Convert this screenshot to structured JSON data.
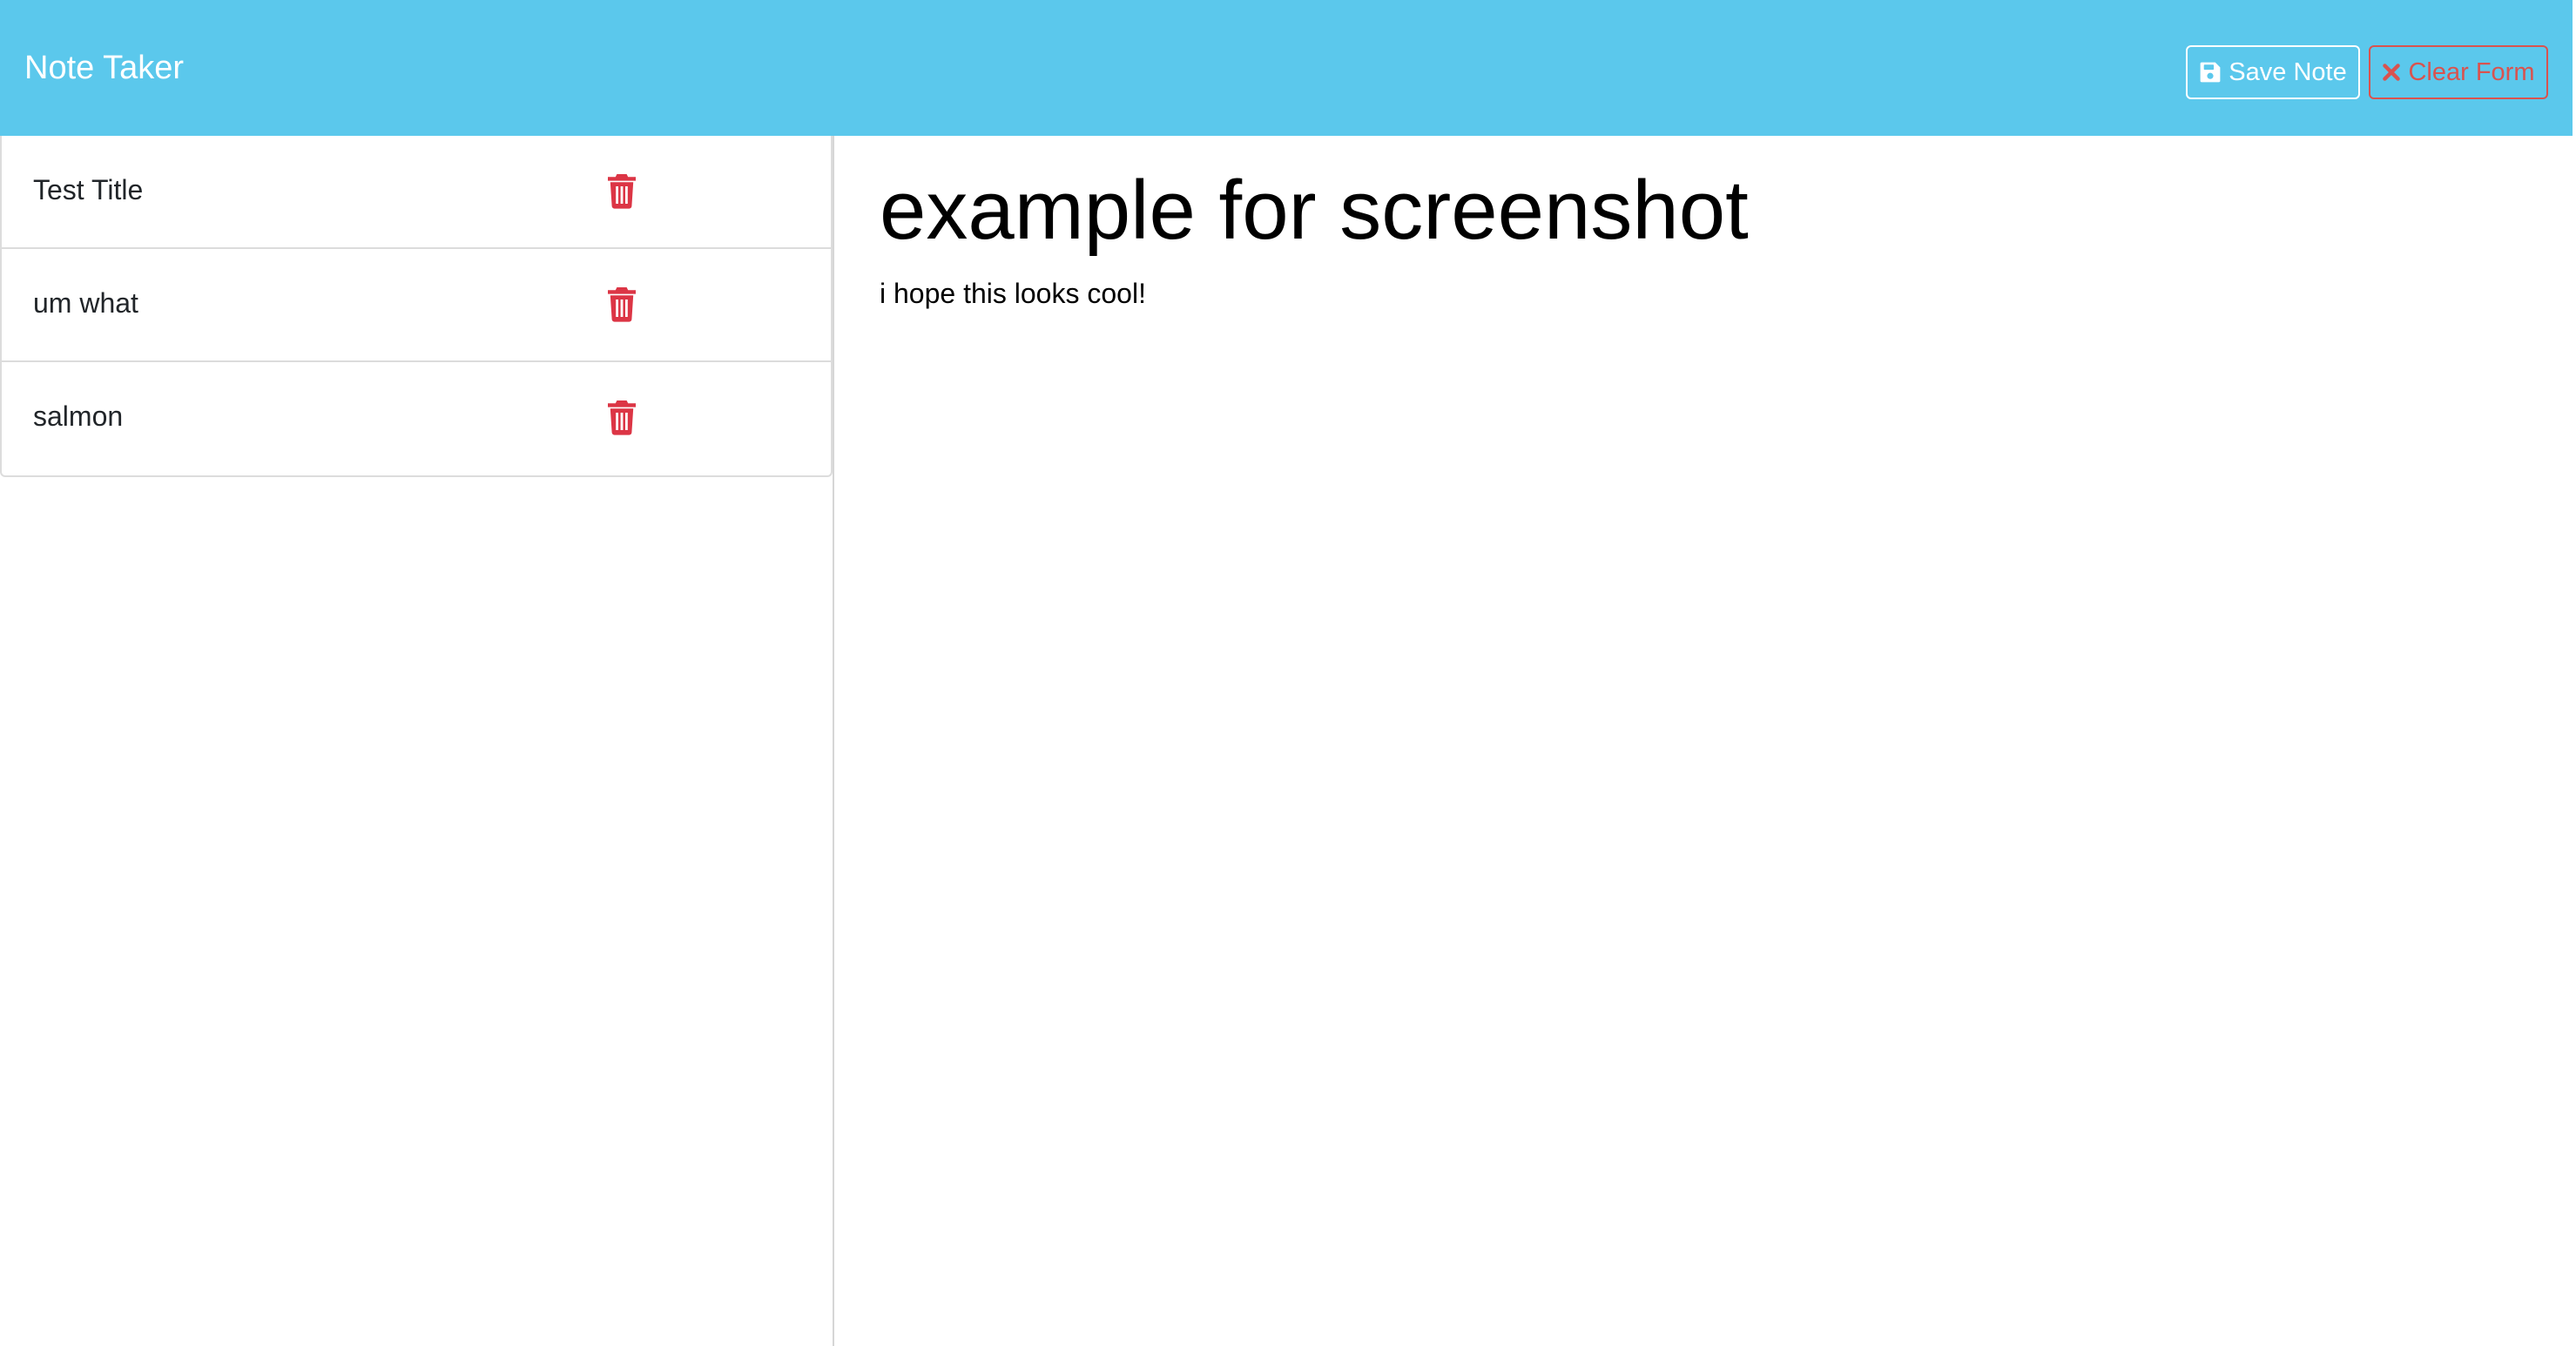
{
  "header": {
    "brand": "Note Taker",
    "save_label": "Save Note",
    "clear_label": "Clear Form",
    "save_icon": "floppy-disk-icon",
    "clear_icon": "close-icon"
  },
  "notes": [
    {
      "title": "Test Title",
      "delete_icon": "trash-icon"
    },
    {
      "title": "um what",
      "delete_icon": "trash-icon"
    },
    {
      "title": "salmon",
      "delete_icon": "trash-icon"
    }
  ],
  "editor": {
    "title": "example for screenshot",
    "text": "i hope this looks cool!"
  },
  "colors": {
    "navbar": "#5bc8ec",
    "danger": "#d9534f",
    "trash": "#dc3545"
  }
}
